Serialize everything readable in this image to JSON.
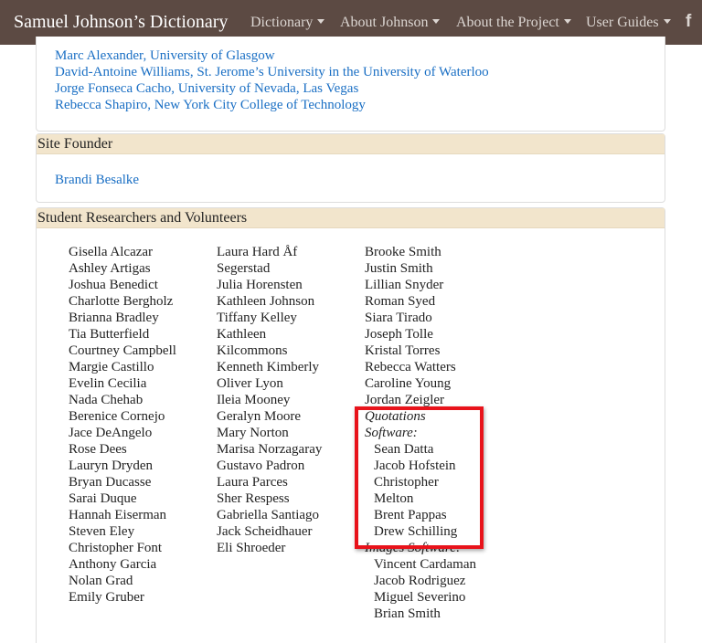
{
  "nav": {
    "brand": "Samuel Johnson’s Dictionary",
    "items": [
      "Dictionary",
      "About Johnson",
      "About the Project",
      "User Guides"
    ],
    "social_glyph": "f"
  },
  "advisors": [
    "Marc Alexander, University of Glasgow",
    "David-Antoine Williams, St. Jerome’s University in the University of Waterloo",
    "Jorge Fonseca Cacho, University of Nevada, Las Vegas",
    "Rebecca Shapiro, New York City College of Technology"
  ],
  "founder": {
    "heading": "Site Founder",
    "name": "Brandi Besalke"
  },
  "students": {
    "heading": "Student Researchers and Volunteers",
    "col1": [
      "Gisella Alcazar",
      "Ashley Artigas",
      "Joshua Benedict",
      "Charlotte Bergholz",
      "Brianna Bradley",
      "Tia Butterfield",
      "Courtney Campbell",
      "Margie Castillo",
      "Evelin Cecilia",
      "Nada Chehab",
      "Berenice Cornejo",
      "Jace DeAngelo",
      "Rose Dees",
      "Lauryn Dryden",
      "Bryan Ducasse",
      "Sarai Duque",
      "Hannah Eiserman",
      "Steven Eley",
      "Christopher Font",
      "Anthony Garcia",
      "Nolan Grad",
      "Emily Gruber"
    ],
    "col2": [
      "Laura Hard Åf",
      "Segerstad",
      "Julia Horensten",
      "Kathleen Johnson",
      "Tiffany Kelley",
      "Kathleen",
      "Kilcommons",
      "Kenneth Kimberly",
      "Oliver Lyon",
      "Ileia Mooney",
      "Geralyn Moore",
      "Mary Norton",
      "Marisa Norzagaray",
      "Gustavo Padron",
      "Laura Parces",
      "Sher Respess",
      "Gabriella Santiago",
      "Jack Scheidhauer",
      "Eli Shroeder"
    ],
    "col3": [
      "Brooke Smith",
      "Justin Smith",
      "Lillian Snyder",
      "Roman Syed",
      "Siara Tirado",
      "Joseph Tolle",
      "Kristal Torres",
      "Rebecca Watters",
      "Caroline Young",
      "Jordan Zeigler"
    ],
    "quotations_label_1": "Quotations",
    "quotations_label_2": "Software:",
    "quotations_people": [
      "Sean Datta",
      "Jacob Hofstein",
      "Christopher",
      "Melton",
      "Brent Pappas",
      "Drew Schilling"
    ],
    "images_label": "Images Software:",
    "images_people": [
      "Vincent Cardaman",
      "Jacob Rodriguez",
      "Miguel Severino",
      "Brian Smith"
    ]
  }
}
